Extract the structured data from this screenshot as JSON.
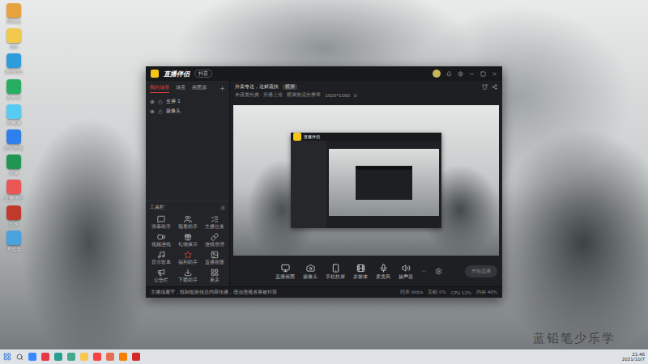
{
  "window": {
    "title": "直播伴侣",
    "badge": "抖音"
  },
  "sidebar": {
    "tabs": [
      {
        "label": "我的场景",
        "selected": true
      },
      {
        "label": "场景",
        "selected": false
      },
      {
        "label": "画面源",
        "selected": false
      }
    ],
    "scenes": [
      {
        "label": "全屏 1",
        "visible": true
      },
      {
        "label": "摄像头",
        "visible": true
      }
    ],
    "tools_title": "工具栏",
    "tools": [
      {
        "label": "弹幕助手",
        "color": "#bdbdbd"
      },
      {
        "label": "观看助手",
        "color": "#bdbdbd"
      },
      {
        "label": "主播任务",
        "color": "#bdbdbd"
      },
      {
        "label": "视频连线",
        "color": "#bdbdbd"
      },
      {
        "label": "礼物展示",
        "color": "#bdbdbd"
      },
      {
        "label": "连线管理",
        "color": "#bdbdbd"
      },
      {
        "label": "音乐歌单",
        "color": "#bdbdbd"
      },
      {
        "label": "福利助手",
        "color": "#e0433a"
      },
      {
        "label": "直播相册",
        "color": "#bdbdbd"
      },
      {
        "label": "公告栏",
        "color": "#bdbdbd"
      },
      {
        "label": "下载助手",
        "color": "#bdbdbd"
      },
      {
        "label": "更多",
        "color": "#bdbdbd"
      }
    ]
  },
  "info": {
    "title": "外卖专送，送鲜蔬快",
    "tag": "横屏",
    "chips": [
      "未设置分类 · 开播上传",
      "横屏推流分辨率",
      "1920*1080"
    ],
    "count": "0"
  },
  "preview": {
    "inner_title": "直播伴侣"
  },
  "toolbar": {
    "buttons": [
      "直播画面",
      "摄像头",
      "手机投屏",
      "多媒体",
      "麦克风",
      "扬声器"
    ],
    "start": "开始直播"
  },
  "status": {
    "notice": "主播须遵守，抵制低俗信息内容传播，违法违规者将被封禁",
    "stats": [
      "码率 0kb/s",
      "丢帧 0%",
      "CPU 12%",
      "内存 48%"
    ]
  },
  "desktop_icons": [
    {
      "label": "回收站",
      "color": "#e6a23c"
    },
    {
      "label": "QQ",
      "color": "#f2c94c"
    },
    {
      "label": "腾讯QQ",
      "color": "#2d9cdb"
    },
    {
      "label": "爱奇艺",
      "color": "#27ae60"
    },
    {
      "label": "此电脑",
      "color": "#56ccf2"
    },
    {
      "label": "控制面板",
      "color": "#2f80ed"
    },
    {
      "label": "表格",
      "color": "#219653"
    },
    {
      "label": "直播伴侣",
      "color": "#eb5757"
    },
    {
      "label": "剪映",
      "color": "#c0392b"
    },
    {
      "label": "浏览器",
      "color": "#4aa3df"
    }
  ],
  "taskbar": {
    "apps": [
      {
        "color": "#3a86ff"
      },
      {
        "color": "#e63946"
      },
      {
        "color": "#2a9d8f"
      },
      {
        "color": "#43aa8b"
      },
      {
        "color": "#f9c74f"
      },
      {
        "color": "#f94144"
      },
      {
        "color": "#e76f51"
      },
      {
        "color": "#f77f00"
      },
      {
        "color": "#d62828"
      }
    ],
    "time": "21:48",
    "date": "2021/10/7"
  },
  "watermark": "蓝铅笔少乐学"
}
